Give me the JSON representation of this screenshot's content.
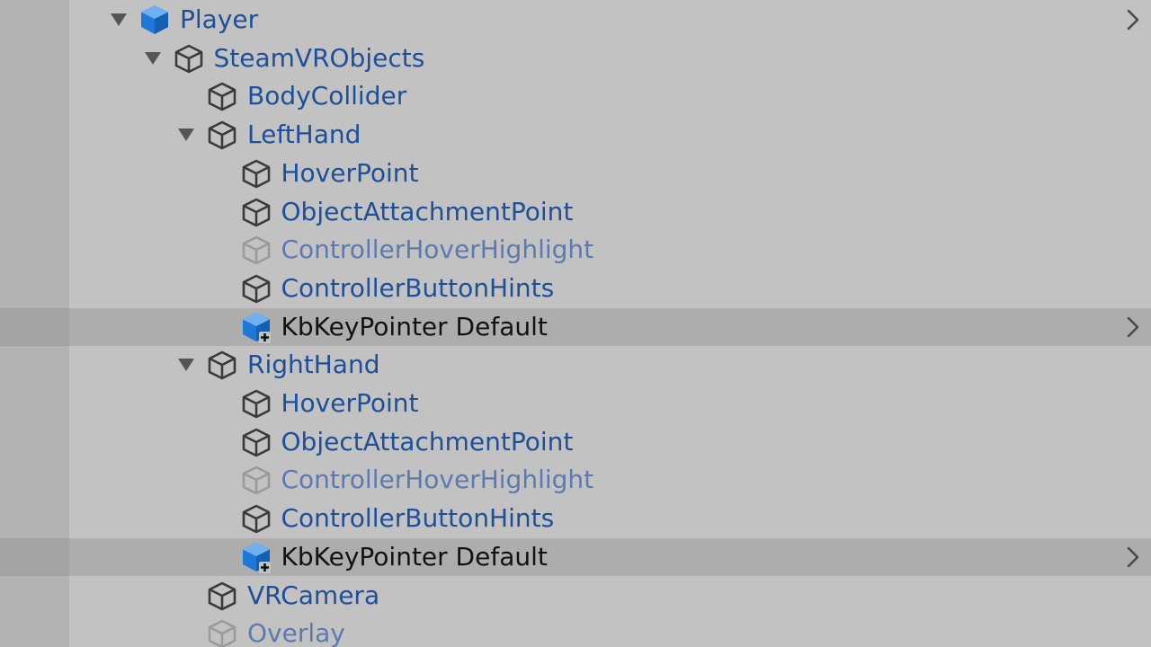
{
  "hierarchy": {
    "rows": [
      {
        "name": "Player",
        "depth": 0,
        "expanded": true,
        "icon": "prefab-root-icon",
        "style": "prefab",
        "chevron": true,
        "highlight": false
      },
      {
        "name": "SteamVRObjects",
        "depth": 1,
        "expanded": true,
        "icon": "gameobject-icon",
        "style": "prefab",
        "chevron": false,
        "highlight": false
      },
      {
        "name": "BodyCollider",
        "depth": 2,
        "expanded": null,
        "icon": "gameobject-icon",
        "style": "prefab",
        "chevron": false,
        "highlight": false
      },
      {
        "name": "LeftHand",
        "depth": 2,
        "expanded": true,
        "icon": "gameobject-icon",
        "style": "prefab",
        "chevron": false,
        "highlight": false
      },
      {
        "name": "HoverPoint",
        "depth": 3,
        "expanded": null,
        "icon": "gameobject-icon",
        "style": "prefab",
        "chevron": false,
        "highlight": false
      },
      {
        "name": "ObjectAttachmentPoint",
        "depth": 3,
        "expanded": null,
        "icon": "gameobject-icon",
        "style": "prefab",
        "chevron": false,
        "highlight": false
      },
      {
        "name": "ControllerHoverHighlight",
        "depth": 3,
        "expanded": null,
        "icon": "gameobject-inactive-icon",
        "style": "prefab-dim",
        "chevron": false,
        "highlight": false
      },
      {
        "name": "ControllerButtonHints",
        "depth": 3,
        "expanded": null,
        "icon": "gameobject-icon",
        "style": "prefab",
        "chevron": false,
        "highlight": false
      },
      {
        "name": "KbKeyPointer Default",
        "depth": 3,
        "expanded": null,
        "icon": "added-prefab-icon",
        "style": "normal",
        "chevron": true,
        "highlight": true
      },
      {
        "name": "RightHand",
        "depth": 2,
        "expanded": true,
        "icon": "gameobject-icon",
        "style": "prefab",
        "chevron": false,
        "highlight": false
      },
      {
        "name": "HoverPoint",
        "depth": 3,
        "expanded": null,
        "icon": "gameobject-icon",
        "style": "prefab",
        "chevron": false,
        "highlight": false
      },
      {
        "name": "ObjectAttachmentPoint",
        "depth": 3,
        "expanded": null,
        "icon": "gameobject-icon",
        "style": "prefab",
        "chevron": false,
        "highlight": false
      },
      {
        "name": "ControllerHoverHighlight",
        "depth": 3,
        "expanded": null,
        "icon": "gameobject-inactive-icon",
        "style": "prefab-dim",
        "chevron": false,
        "highlight": false
      },
      {
        "name": "ControllerButtonHints",
        "depth": 3,
        "expanded": null,
        "icon": "gameobject-icon",
        "style": "prefab",
        "chevron": false,
        "highlight": false
      },
      {
        "name": "KbKeyPointer Default",
        "depth": 3,
        "expanded": null,
        "icon": "added-prefab-icon",
        "style": "normal",
        "chevron": true,
        "highlight": true
      },
      {
        "name": "VRCamera",
        "depth": 2,
        "expanded": null,
        "icon": "gameobject-icon",
        "style": "prefab",
        "chevron": false,
        "highlight": false
      },
      {
        "name": "Overlay",
        "depth": 2,
        "expanded": null,
        "icon": "gameobject-inactive-icon",
        "style": "prefab-dim",
        "chevron": false,
        "highlight": false
      }
    ]
  },
  "colors": {
    "prefab_text": "#1d4f9a",
    "prefab_dim_text": "#5d7ab0",
    "normal_text": "#121212",
    "prefab_icon_blue": "#1f78d8",
    "panel_bg": "#c2c2c2",
    "gutter_bg": "#b2b2b2",
    "highlight_bg": "#adadad"
  }
}
